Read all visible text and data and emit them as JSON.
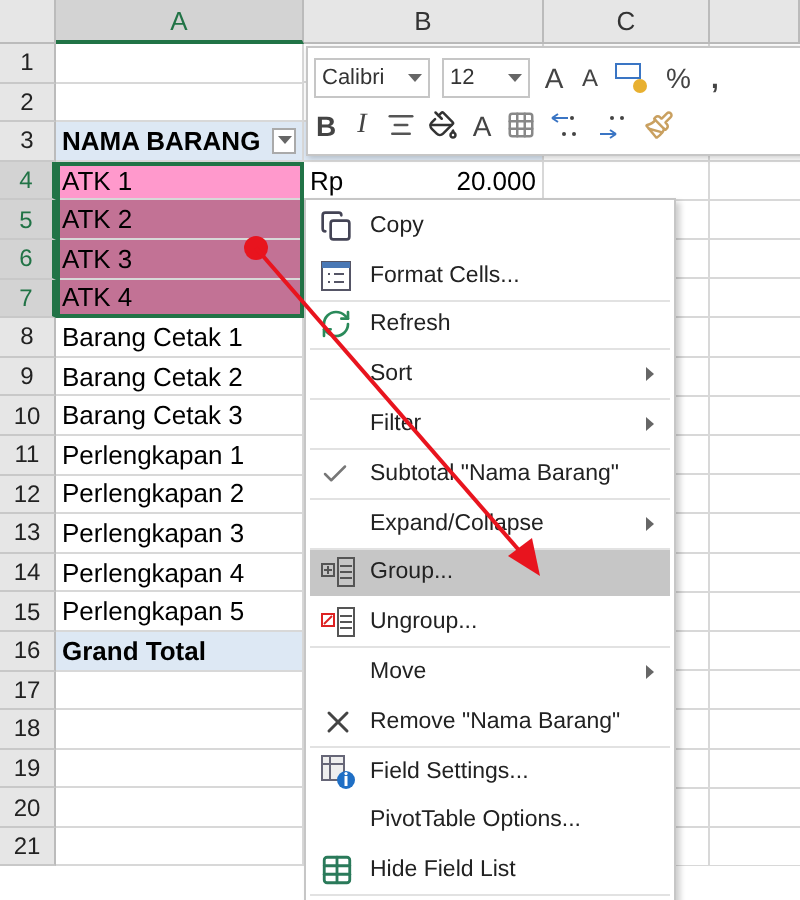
{
  "columns": [
    {
      "label": "A",
      "selected": true
    },
    {
      "label": "B",
      "selected": false
    },
    {
      "label": "C",
      "selected": false
    }
  ],
  "rows": [
    {
      "number": "1",
      "selected": false,
      "kind": "plain"
    },
    {
      "number": "2",
      "selected": false,
      "kind": "plain"
    },
    {
      "number": "3",
      "selected": false,
      "a": "NAMA BARANG",
      "kind": "header",
      "filter": true
    },
    {
      "number": "4",
      "selected": true,
      "a": "ATK 1",
      "kind": "active",
      "b_currency": "Rp",
      "b_value": "20.000"
    },
    {
      "number": "5",
      "selected": true,
      "a": "ATK 2",
      "kind": "selected"
    },
    {
      "number": "6",
      "selected": true,
      "a": "ATK 3",
      "kind": "selected"
    },
    {
      "number": "7",
      "selected": true,
      "a": "ATK 4",
      "kind": "selected"
    },
    {
      "number": "8",
      "selected": false,
      "a": "Barang Cetak 1",
      "kind": "plain"
    },
    {
      "number": "9",
      "selected": false,
      "a": "Barang Cetak 2",
      "kind": "plain"
    },
    {
      "number": "10",
      "selected": false,
      "a": "Barang Cetak 3",
      "kind": "plain"
    },
    {
      "number": "11",
      "selected": false,
      "a": "Perlengkapan 1",
      "kind": "plain"
    },
    {
      "number": "12",
      "selected": false,
      "a": "Perlengkapan 2",
      "kind": "plain"
    },
    {
      "number": "13",
      "selected": false,
      "a": "Perlengkapan 3",
      "kind": "plain"
    },
    {
      "number": "14",
      "selected": false,
      "a": "Perlengkapan 4",
      "kind": "plain"
    },
    {
      "number": "15",
      "selected": false,
      "a": "Perlengkapan 5",
      "kind": "plain"
    },
    {
      "number": "16",
      "selected": false,
      "a": "Grand Total",
      "kind": "total"
    },
    {
      "number": "17",
      "selected": false,
      "kind": "plain"
    },
    {
      "number": "18",
      "selected": false,
      "kind": "plain"
    },
    {
      "number": "19",
      "selected": false,
      "kind": "plain"
    },
    {
      "number": "20",
      "selected": false,
      "kind": "plain"
    },
    {
      "number": "21",
      "selected": false,
      "kind": "plain"
    }
  ],
  "mini_toolbar": {
    "font": "Calibri",
    "size": "12",
    "grow_font": "A",
    "shrink_font": "A",
    "percent": "%",
    "comma": ",",
    "bold": "B",
    "italic": "I",
    "font_color": "A"
  },
  "context_menu": [
    {
      "label": "Copy",
      "selected": false,
      "submenu": false,
      "checked": false,
      "divider": false
    },
    {
      "label": "Format Cells...",
      "selected": false,
      "submenu": false,
      "checked": false,
      "divider": true
    },
    {
      "label": "Refresh",
      "selected": false,
      "submenu": false,
      "checked": false,
      "divider": true
    },
    {
      "label": "Sort",
      "selected": false,
      "submenu": true,
      "checked": false,
      "divider": true
    },
    {
      "label": "Filter",
      "selected": false,
      "submenu": true,
      "checked": false,
      "divider": true
    },
    {
      "label": "Subtotal \"Nama Barang\"",
      "selected": false,
      "submenu": false,
      "checked": true,
      "divider": true
    },
    {
      "label": "Expand/Collapse",
      "selected": false,
      "submenu": true,
      "checked": false,
      "divider": true
    },
    {
      "label": "Group...",
      "selected": true,
      "submenu": false,
      "checked": false,
      "divider": false
    },
    {
      "label": "Ungroup...",
      "selected": false,
      "submenu": false,
      "checked": false,
      "divider": true
    },
    {
      "label": "Move",
      "selected": false,
      "submenu": true,
      "checked": false,
      "divider": false
    },
    {
      "label": "Remove \"Nama Barang\"",
      "selected": false,
      "submenu": false,
      "checked": false,
      "divider": true
    },
    {
      "label": "Field Settings...",
      "selected": false,
      "submenu": false,
      "checked": false,
      "divider": false
    },
    {
      "label": "PivotTable Options...",
      "selected": false,
      "submenu": false,
      "checked": false,
      "divider": false
    },
    {
      "label": "Hide Field List",
      "selected": false,
      "submenu": false,
      "checked": false,
      "divider": true
    }
  ]
}
